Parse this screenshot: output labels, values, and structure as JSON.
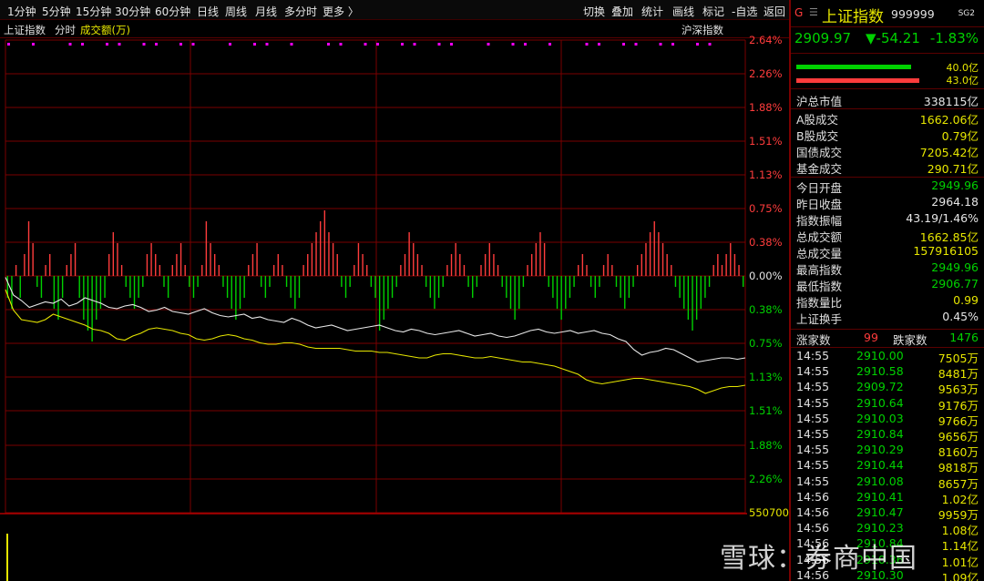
{
  "toolbar": {
    "periods": [
      "1分钟",
      "5分钟",
      "15分钟",
      "30分钟",
      "60分钟",
      "日线",
      "周线",
      "月线",
      "多分时",
      "更多 〉"
    ],
    "actions": [
      "切换",
      "叠加",
      "统计",
      "画线",
      "标记",
      "-自选",
      "返回"
    ]
  },
  "subbar": {
    "index_name": "上证指数",
    "mode": "分时",
    "indicator": "成交额(万)",
    "compare_label": "沪深指数"
  },
  "axis": {
    "right_labels": [
      "2.64%",
      "2.26%",
      "1.88%",
      "1.51%",
      "1.13%",
      "0.75%",
      "0.38%",
      "0.00%",
      "0.38%",
      "0.75%",
      "1.13%",
      "1.51%",
      "1.88%",
      "2.26%",
      "550700"
    ]
  },
  "header": {
    "g_icon": "G",
    "menu_icon": "☰",
    "name": "上证指数",
    "code": "999999",
    "tag": "SG2"
  },
  "price": {
    "last": "2909.97",
    "change": "▼-54.21",
    "pct": "-1.83%"
  },
  "bars": {
    "up_ratio": "40.0亿",
    "down_ratio": "43.0亿"
  },
  "stats_top": [
    {
      "label": "沪总市值",
      "value": "338115亿",
      "color": "#e6e6e6"
    }
  ],
  "stats_turnover": [
    {
      "label": "A股成交",
      "value": "1662.06亿",
      "color": "#e6e600"
    },
    {
      "label": "B股成交",
      "value": "0.79亿",
      "color": "#e6e600"
    },
    {
      "label": "国债成交",
      "value": "7205.42亿",
      "color": "#e6e600"
    },
    {
      "label": "基金成交",
      "value": "290.71亿",
      "color": "#e6e600"
    }
  ],
  "stats_main": [
    {
      "label": "今日开盘",
      "value": "2949.96",
      "color": "#00d200"
    },
    {
      "label": "昨日收盘",
      "value": "2964.18",
      "color": "#e6e6e6"
    },
    {
      "label": "指数振幅",
      "value": "43.19/1.46%",
      "color": "#e6e6e6"
    },
    {
      "label": "总成交额",
      "value": "1662.85亿",
      "color": "#e6e600"
    },
    {
      "label": "总成交量",
      "value": "157916105",
      "color": "#e6e600"
    },
    {
      "label": "最高指数",
      "value": "2949.96",
      "color": "#00d200"
    },
    {
      "label": "最低指数",
      "value": "2906.77",
      "color": "#00d200"
    },
    {
      "label": "指数量比",
      "value": "0.99",
      "color": "#e6e600"
    },
    {
      "label": "上证换手",
      "value": "0.45%",
      "color": "#e6e6e6"
    }
  ],
  "breadth": {
    "up_label": "涨家数",
    "up_value": "99",
    "down_label": "跌家数",
    "down_value": "1476"
  },
  "ticks": [
    {
      "time": "14:55",
      "price": "2910.00",
      "vol": "7505万"
    },
    {
      "time": "14:55",
      "price": "2910.58",
      "vol": "8481万"
    },
    {
      "time": "14:55",
      "price": "2909.72",
      "vol": "9563万"
    },
    {
      "time": "14:55",
      "price": "2910.64",
      "vol": "9176万"
    },
    {
      "time": "14:55",
      "price": "2910.03",
      "vol": "9766万"
    },
    {
      "time": "14:55",
      "price": "2910.84",
      "vol": "9656万"
    },
    {
      "time": "14:55",
      "price": "2910.29",
      "vol": "8160万"
    },
    {
      "time": "14:55",
      "price": "2910.44",
      "vol": "9818万"
    },
    {
      "time": "14:55",
      "price": "2910.08",
      "vol": "8657万"
    },
    {
      "time": "14:56",
      "price": "2910.41",
      "vol": "1.02亿"
    },
    {
      "time": "14:56",
      "price": "2910.47",
      "vol": "9959万"
    },
    {
      "time": "14:56",
      "price": "2910.23",
      "vol": "1.08亿"
    },
    {
      "time": "14:56",
      "price": "2910.84",
      "vol": "1.14亿"
    },
    {
      "time": "14:56",
      "price": "2910.36",
      "vol": "1.01亿"
    },
    {
      "time": "14:56",
      "price": "2910.30",
      "vol": "1.09亿"
    }
  ],
  "watermark": "雪球：券商中国",
  "colors": {
    "up": "#ff3c3c",
    "down": "#00d200",
    "volume": "#e6e600",
    "grid": "#7a0000"
  },
  "series": {
    "white_line": [
      -0.1,
      -1.4,
      -1.8,
      -2.3,
      -2.1,
      -1.9,
      -2.0,
      -1.7,
      -2.2,
      -2.0,
      -1.6,
      -1.8,
      -2.0,
      -2.3,
      -2.4,
      -2.2,
      -2.1,
      -2.3,
      -2.6,
      -2.5,
      -2.3,
      -2.6,
      -2.7,
      -2.8,
      -2.6,
      -2.4,
      -2.7,
      -2.9,
      -3.0,
      -2.9,
      -2.8,
      -3.1,
      -3.0,
      -3.2,
      -3.3,
      -3.4,
      -3.1,
      -3.3,
      -3.6,
      -3.8,
      -3.7,
      -3.6,
      -3.8,
      -4.0,
      -3.9,
      -3.8,
      -3.7,
      -3.6,
      -3.8,
      -4.0,
      -4.1,
      -3.9,
      -4.0,
      -4.2,
      -4.3,
      -4.2,
      -4.1,
      -4.0,
      -4.2,
      -4.4,
      -4.3,
      -4.2,
      -4.4,
      -4.5,
      -4.4,
      -4.2,
      -4.0,
      -3.9,
      -4.1,
      -4.2,
      -4.1,
      -4.0,
      -4.2,
      -4.1,
      -4.0,
      -4.2,
      -4.3,
      -4.6,
      -4.8,
      -5.4,
      -5.8,
      -5.6,
      -5.5,
      -5.3,
      -5.4,
      -5.7,
      -6.0,
      -6.3,
      -6.2,
      -6.1,
      -6.0,
      -6.0,
      -6.1,
      -6.0
    ],
    "yellow_line": [
      -1.0,
      -2.5,
      -3.2,
      -3.3,
      -3.4,
      -3.2,
      -2.8,
      -3.0,
      -3.2,
      -3.4,
      -3.6,
      -3.9,
      -4.0,
      -4.2,
      -4.6,
      -4.7,
      -4.4,
      -4.2,
      -3.9,
      -3.8,
      -3.9,
      -4.0,
      -4.2,
      -4.3,
      -4.6,
      -4.7,
      -4.6,
      -4.4,
      -4.3,
      -4.4,
      -4.6,
      -4.7,
      -4.9,
      -5.0,
      -5.0,
      -4.9,
      -4.9,
      -5.0,
      -5.2,
      -5.3,
      -5.3,
      -5.3,
      -5.3,
      -5.4,
      -5.5,
      -5.5,
      -5.5,
      -5.6,
      -5.6,
      -5.7,
      -5.8,
      -5.9,
      -6.0,
      -6.0,
      -5.8,
      -5.7,
      -5.7,
      -5.8,
      -5.9,
      -6.0,
      -6.0,
      -5.9,
      -6.0,
      -6.1,
      -6.2,
      -6.3,
      -6.3,
      -6.4,
      -6.5,
      -6.6,
      -6.8,
      -7.0,
      -7.2,
      -7.6,
      -7.8,
      -7.9,
      -7.8,
      -7.7,
      -7.6,
      -7.5,
      -7.5,
      -7.6,
      -7.7,
      -7.8,
      -7.9,
      -8.0,
      -8.1,
      -8.3,
      -8.6,
      -8.4,
      -8.2,
      -8.1,
      -8.1,
      -8.0
    ],
    "breadth_bars": [
      -2,
      -3,
      1,
      -2,
      2,
      5,
      3,
      -1,
      -2,
      1,
      2,
      -3,
      -4,
      -2,
      1,
      2,
      3,
      -2,
      -4,
      -5,
      -6,
      -4,
      -3,
      -2,
      2,
      4,
      3,
      1,
      -1,
      -2,
      -3,
      -2,
      -1,
      2,
      3,
      2,
      1,
      -1,
      -2,
      1,
      2,
      3,
      1,
      -1,
      -2,
      -1,
      1,
      5,
      3,
      2,
      1,
      -1,
      -2,
      -3,
      -4,
      -3,
      -2,
      1,
      2,
      3,
      -1,
      -2,
      -1,
      1,
      2,
      1,
      -1,
      -2,
      -3,
      -2,
      1,
      2,
      3,
      4,
      5,
      6,
      4,
      3,
      2,
      -1,
      -2,
      -1,
      1,
      3,
      2,
      1,
      -1,
      -2,
      -5,
      -4,
      -3,
      -2,
      -1,
      1,
      2,
      4,
      3,
      2,
      1,
      -1,
      -2,
      -3,
      -2,
      -1,
      1,
      2,
      3,
      2,
      1,
      -1,
      -2,
      -1,
      1,
      2,
      3,
      2,
      1,
      -1,
      -2,
      -3,
      -4,
      -3,
      -1,
      1,
      2,
      3,
      4,
      3,
      -1,
      -2,
      -3,
      -4,
      -3,
      -2,
      -1,
      1,
      2,
      1,
      -1,
      -2,
      -1,
      1,
      2,
      1,
      -1,
      -2,
      -3,
      -2,
      -1,
      1,
      2,
      3,
      4,
      5,
      4,
      3,
      2,
      1,
      -1,
      -2,
      -3,
      -4,
      -5,
      -4,
      -3,
      -2,
      -1,
      1,
      2,
      1,
      2,
      3,
      2,
      1,
      -1
    ]
  }
}
